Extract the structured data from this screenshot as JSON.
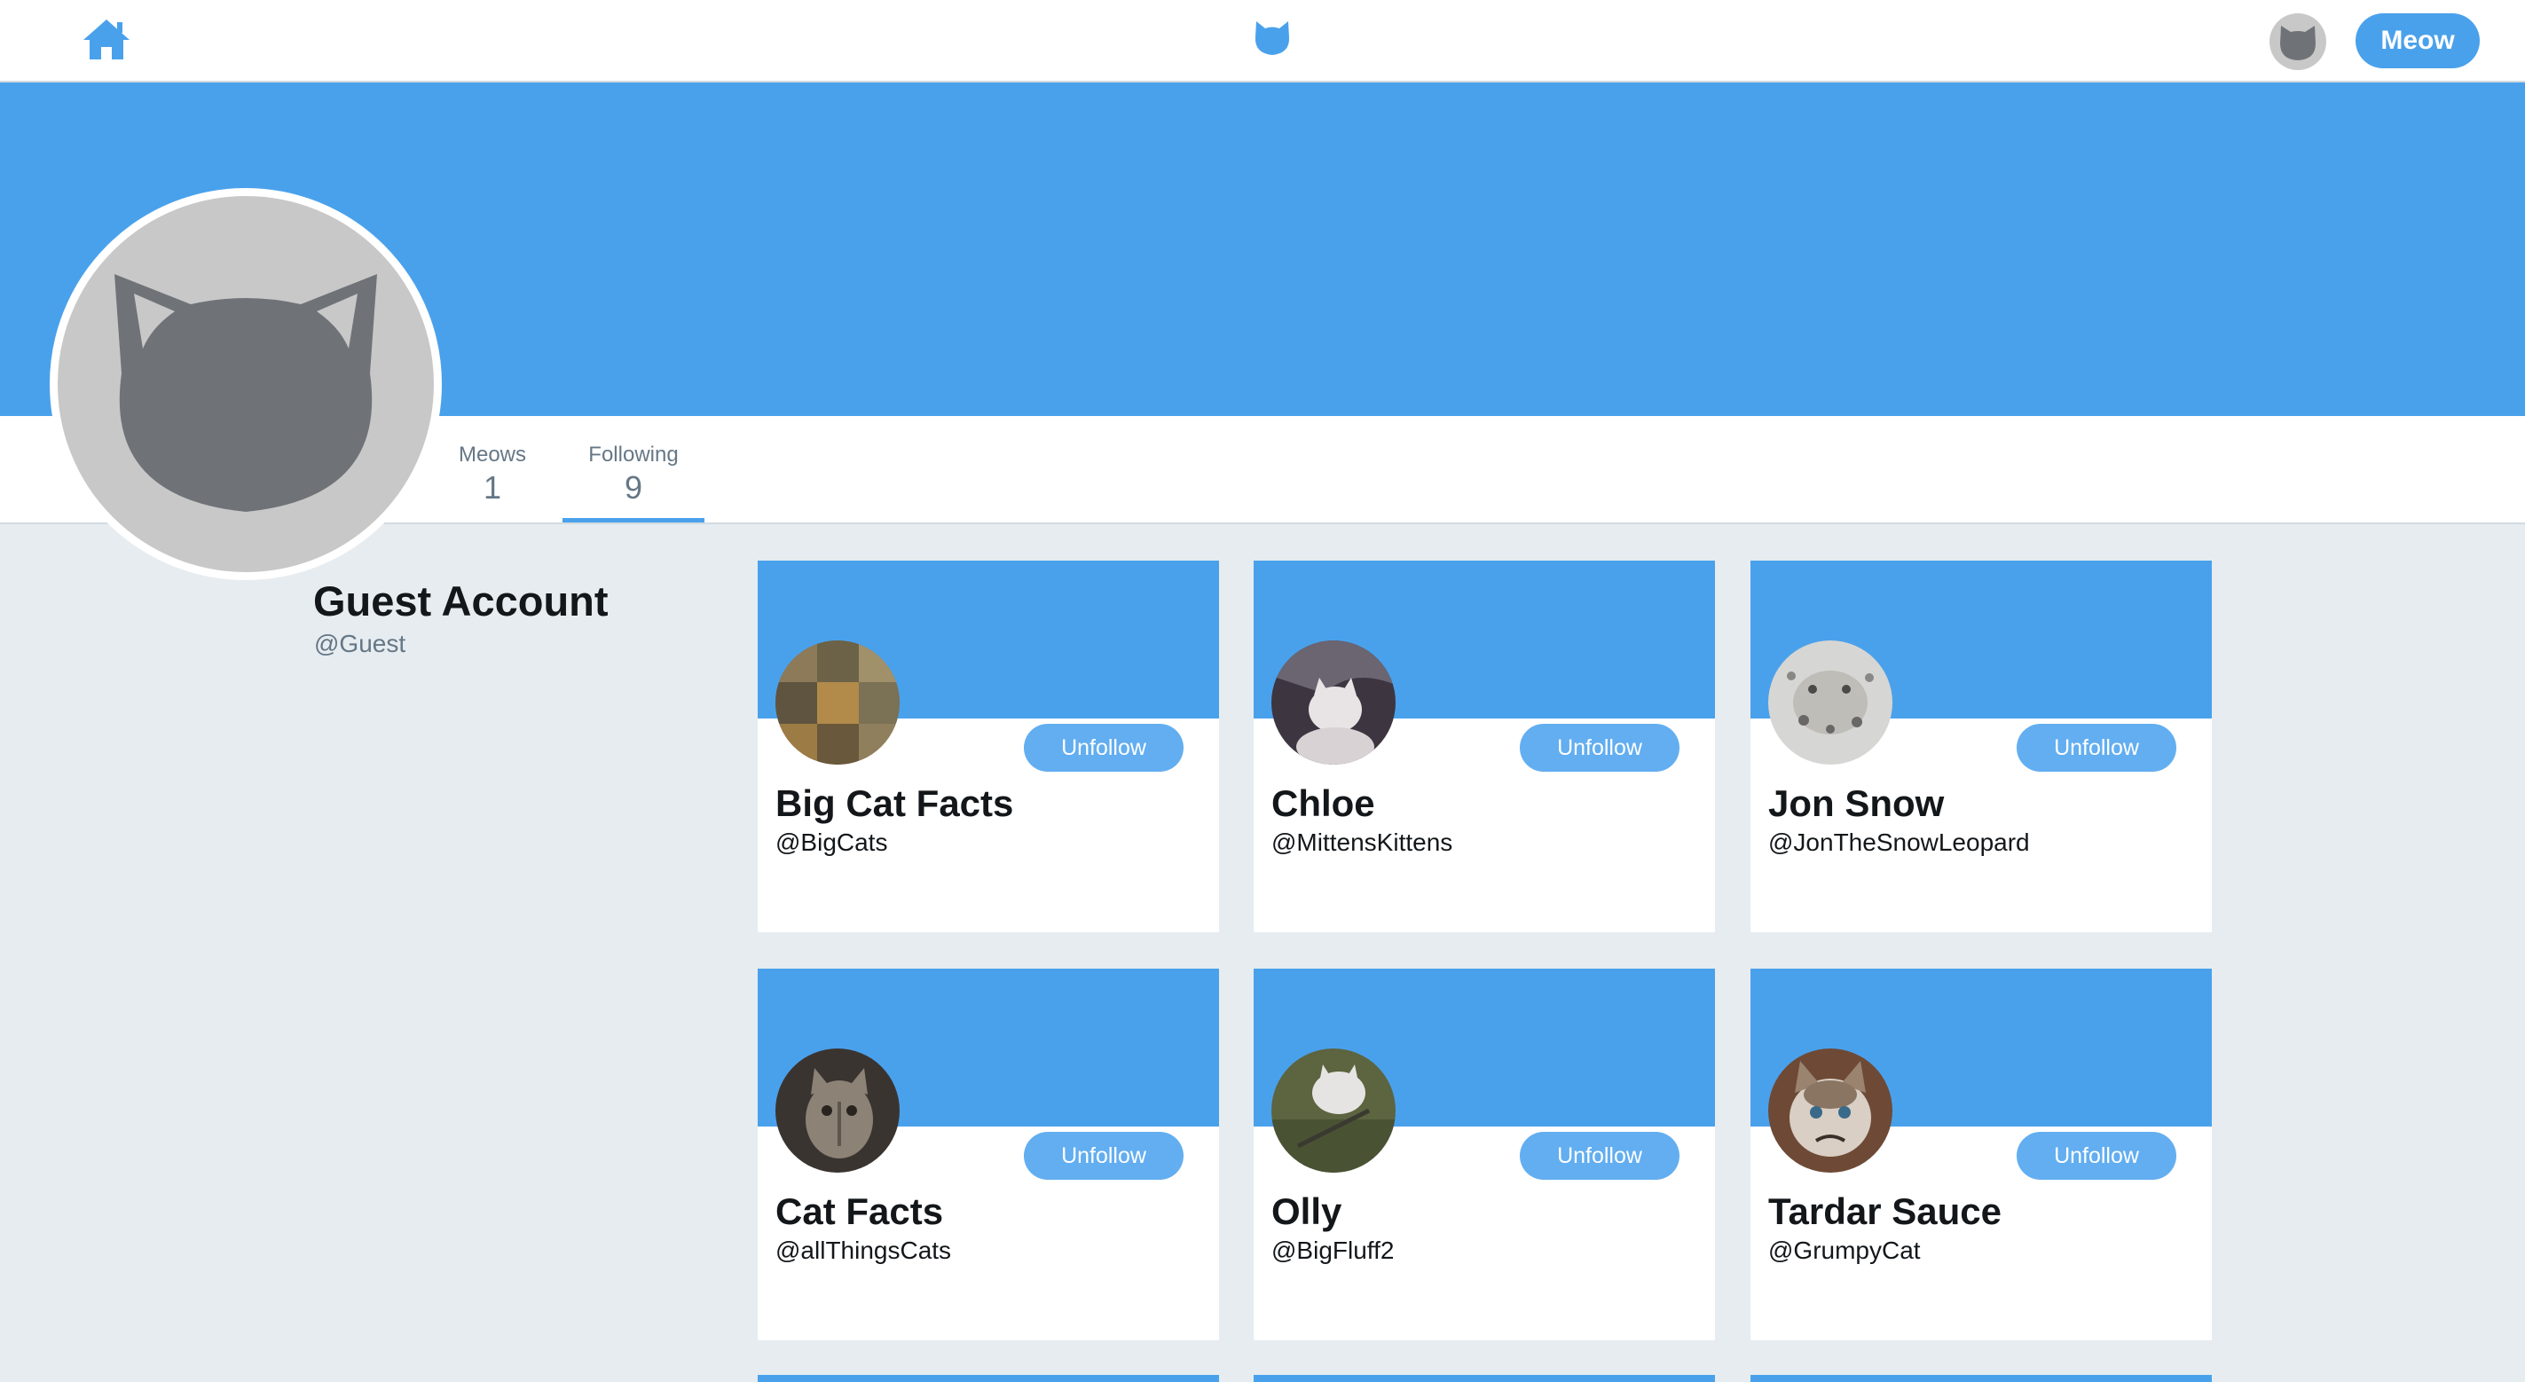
{
  "header": {
    "home_icon": "home-icon",
    "logo_icon": "cat-logo-icon",
    "avatar_icon": "cat-avatar-icon",
    "meow_label": "Meow"
  },
  "colors": {
    "brand": "#4aa1eb",
    "page_background": "#e6ecf0",
    "avatar_gray": "#6f7377",
    "avatar_background": "#c8c8c8"
  },
  "profile": {
    "name": "Guest Account",
    "handle": "@Guest",
    "stats": [
      {
        "label": "Meows",
        "value": "1"
      },
      {
        "label": "Following",
        "value": "9",
        "active": true
      }
    ]
  },
  "following": {
    "button_label": "Unfollow",
    "cards": [
      {
        "name": "Big Cat Facts",
        "handle": "@BigCats"
      },
      {
        "name": "Chloe",
        "handle": "@MittensKittens"
      },
      {
        "name": "Jon Snow",
        "handle": "@JonTheSnowLeopard"
      },
      {
        "name": "Cat Facts",
        "handle": "@allThingsCats"
      },
      {
        "name": "Olly",
        "handle": "@BigFluff2"
      },
      {
        "name": "Tardar Sauce",
        "handle": "@GrumpyCat"
      }
    ]
  }
}
